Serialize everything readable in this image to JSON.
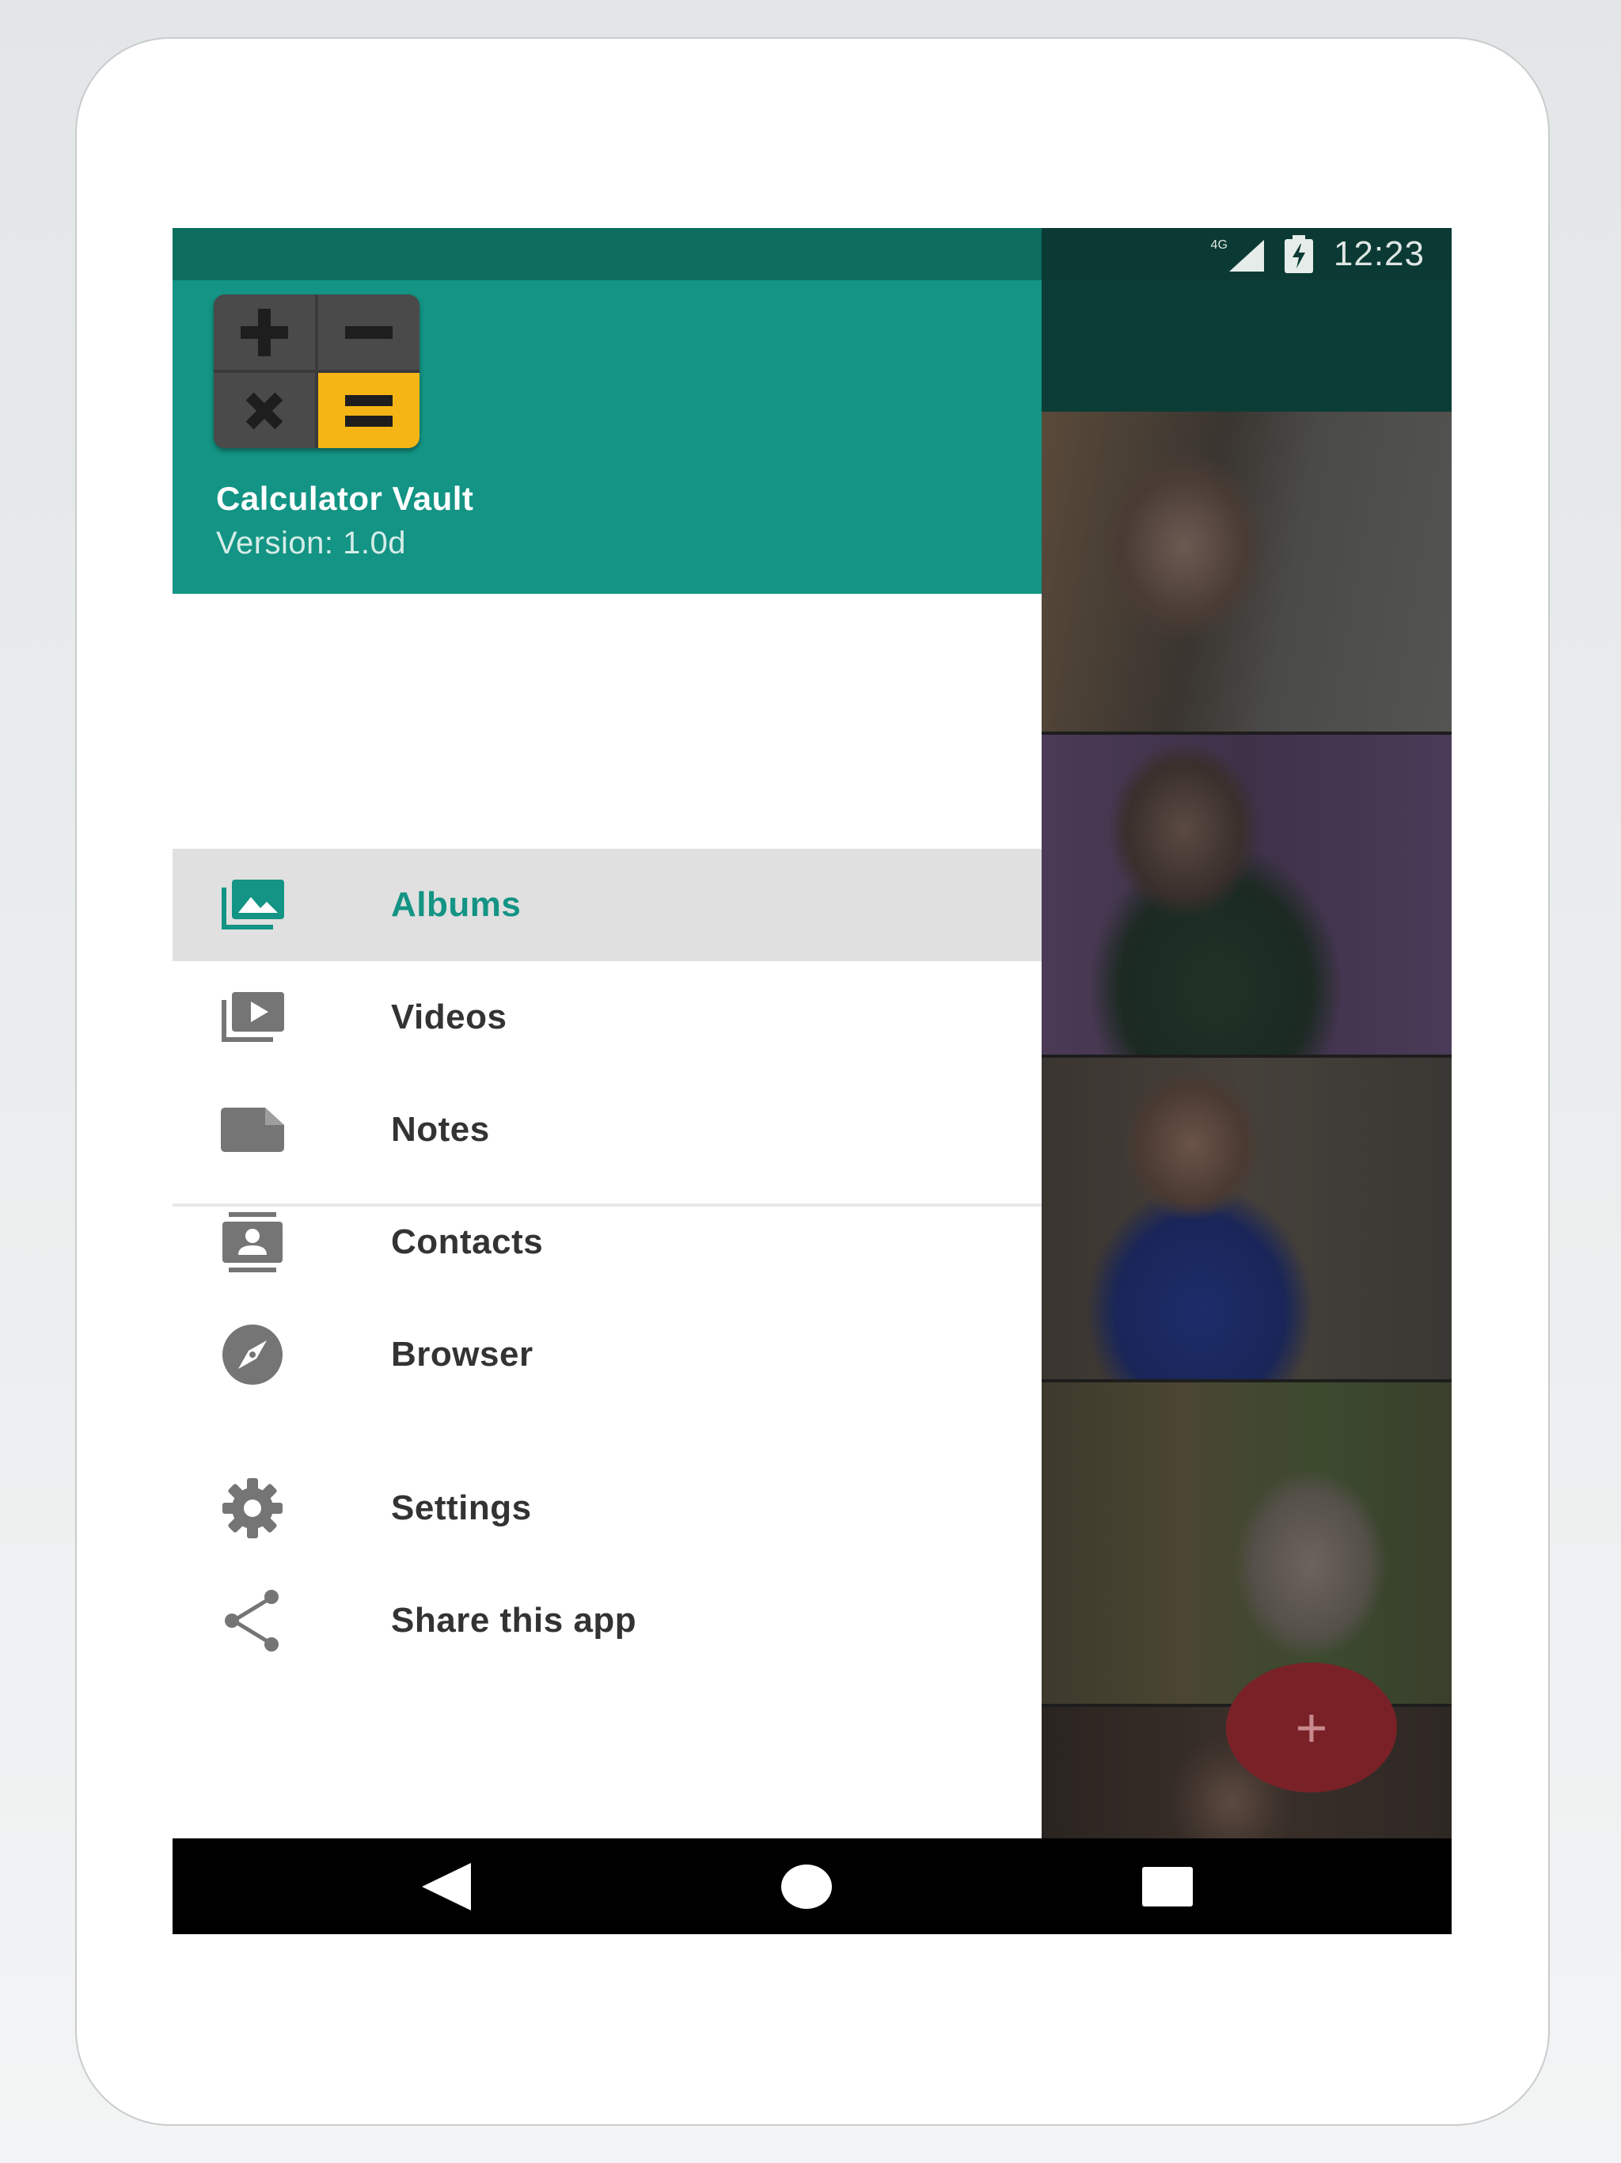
{
  "status_bar": {
    "network_label": "4G",
    "time": "12:23"
  },
  "drawer": {
    "app_name": "Calculator Vault",
    "version": "Version: 1.0d",
    "items": [
      {
        "label": "Albums",
        "icon": "photo-album-icon",
        "selected": true
      },
      {
        "label": "Videos",
        "icon": "video-library-icon",
        "selected": false
      },
      {
        "label": "Notes",
        "icon": "note-icon",
        "selected": false
      },
      {
        "label": "Contacts",
        "icon": "contacts-icon",
        "selected": false
      },
      {
        "label": "Browser",
        "icon": "compass-icon",
        "selected": false
      }
    ],
    "secondary_items": [
      {
        "label": "Settings",
        "icon": "gear-icon"
      },
      {
        "label": "Share this app",
        "icon": "share-icon"
      }
    ]
  },
  "fab": {
    "icon": "plus-icon",
    "label": "+"
  },
  "navigation": {
    "back_icon": "back-triangle-icon",
    "home_icon": "home-circle-icon",
    "recents_icon": "recents-square-icon"
  },
  "colors": {
    "primary": "#139484",
    "primary_dark": "#0d6d5f",
    "accent": "#7a2128",
    "logo_equals": "#f5b615"
  }
}
